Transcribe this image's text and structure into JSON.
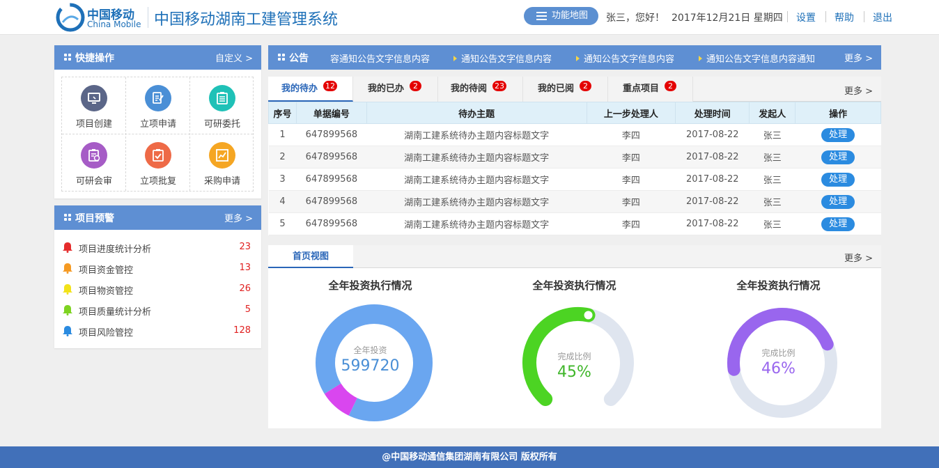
{
  "header": {
    "logo_cn": "中国移动",
    "logo_en": "China Mobile",
    "system_title": "中国移动湖南工建管理系统",
    "function_map": "功能地图",
    "greeting": "张三，您好！",
    "date": "2017年12月21日 星期四",
    "links": [
      "设置",
      "帮助",
      "退出"
    ]
  },
  "quick": {
    "title": "快捷操作",
    "more": "自定义 >",
    "items": [
      {
        "label": "项目创建",
        "icon": "monitor-icon",
        "color": "#5b6688"
      },
      {
        "label": "立项申请",
        "icon": "edit-document-icon",
        "color": "#4a8fd6"
      },
      {
        "label": "可研委托",
        "icon": "clipboard-list-icon",
        "color": "#1fc1b7"
      },
      {
        "label": "可研会审",
        "icon": "review-document-icon",
        "color": "#a65cc6"
      },
      {
        "label": "立项批复",
        "icon": "approval-clipboard-icon",
        "color": "#ee6a47"
      },
      {
        "label": "采购申请",
        "icon": "chart-frame-icon",
        "color": "#f5a623"
      }
    ]
  },
  "warning": {
    "title": "项目预警",
    "more": "更多 >",
    "items": [
      {
        "label": "项目进度统计分析",
        "count": "23",
        "color": "#e52c2c"
      },
      {
        "label": "项目资金管控",
        "count": "13",
        "color": "#f59a23"
      },
      {
        "label": "项目物资管控",
        "count": "26",
        "color": "#f2e21a"
      },
      {
        "label": "项目质量统计分析",
        "count": "5",
        "color": "#7ed321"
      },
      {
        "label": "项目风险管控",
        "count": "128",
        "color": "#2b8be0"
      }
    ]
  },
  "notice": {
    "title": "公告",
    "items": [
      "容通知公告文字信息内容",
      "通知公告文字信息内容",
      "通知公告文字信息内容",
      "通知公告文字信息内容通知"
    ],
    "more": "更多 >"
  },
  "todo": {
    "tabs": [
      {
        "label": "我的待办",
        "badge": "12"
      },
      {
        "label": "我的已办",
        "badge": "2"
      },
      {
        "label": "我的待阅",
        "badge": "23"
      },
      {
        "label": "我的已阅",
        "badge": "2"
      },
      {
        "label": "重点项目",
        "badge": "2"
      }
    ],
    "more": "更多 >",
    "columns": [
      "序号",
      "单据编号",
      "待办主题",
      "上一步处理人",
      "处理时间",
      "发起人",
      "操作"
    ],
    "rows": [
      [
        "1",
        "647899568",
        "湖南工建系统待办主题内容标题文字",
        "李四",
        "2017-08-22",
        "张三",
        "处理"
      ],
      [
        "2",
        "647899568",
        "湖南工建系统待办主题内容标题文字",
        "李四",
        "2017-08-22",
        "张三",
        "处理"
      ],
      [
        "3",
        "647899568",
        "湖南工建系统待办主题内容标题文字",
        "李四",
        "2017-08-22",
        "张三",
        "处理"
      ],
      [
        "4",
        "647899568",
        "湖南工建系统待办主题内容标题文字",
        "李四",
        "2017-08-22",
        "张三",
        "处理"
      ],
      [
        "5",
        "647899568",
        "湖南工建系统待办主题内容标题文字",
        "李四",
        "2017-08-22",
        "张三",
        "处理"
      ]
    ]
  },
  "view": {
    "tab": "首页视图",
    "more": "更多 >"
  },
  "chart_data": [
    {
      "type": "pie",
      "title": "全年投资执行情况",
      "center_label": "全年投资",
      "center_value": "599720",
      "values": [
        0.91,
        0.09
      ],
      "colors": [
        "#6aa6f0",
        "#d946ef"
      ],
      "value_color": "#4a8fd6"
    },
    {
      "type": "pie",
      "title": "全年投资执行情况",
      "center_label": "完成比例",
      "center_value": "45%",
      "values": [
        0.45
      ],
      "colors": [
        "#4cd423"
      ],
      "track_color": "#dfe5ef",
      "value_color": "#3fb62a"
    },
    {
      "type": "pie",
      "title": "全年投资执行情况",
      "center_label": "完成比例",
      "center_value": "46%",
      "values": [
        0.46
      ],
      "colors": [
        "#9966ee"
      ],
      "track_color": "#dfe5ef",
      "value_color": "#9966ee"
    }
  ],
  "footer": "@中国移动通信集团湖南有限公司 版权所有"
}
